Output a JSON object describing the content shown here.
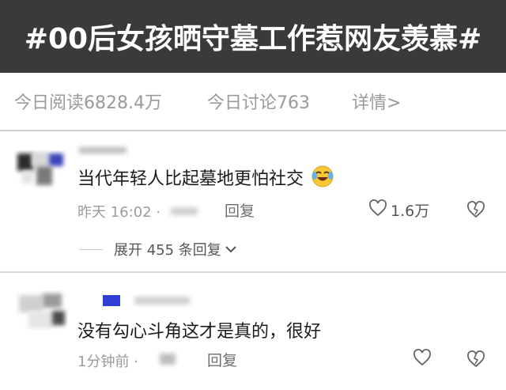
{
  "topic": {
    "title": "#00后女孩晒守墓工作惹网友羡慕#",
    "read_count": "今日阅读6828.4万",
    "discuss_count": "今日讨论763",
    "details_link": "详情>"
  },
  "comments": [
    {
      "text": "当代年轻人比起墓地更怕社交",
      "time": "昨天 16:02 ·",
      "reply_label": "回复",
      "likes": "1.6万",
      "expand_label": "展开 455 条回复"
    },
    {
      "text": "没有勾心斗角这才是真的，很好",
      "time": "1分钟前 ·",
      "reply_label": "回复"
    }
  ],
  "colors": {
    "header_bg": "#3a3a3a",
    "header_text": "#ffffff",
    "muted_text": "#9a9a9a",
    "accent_blue": "#2f3fd6"
  }
}
